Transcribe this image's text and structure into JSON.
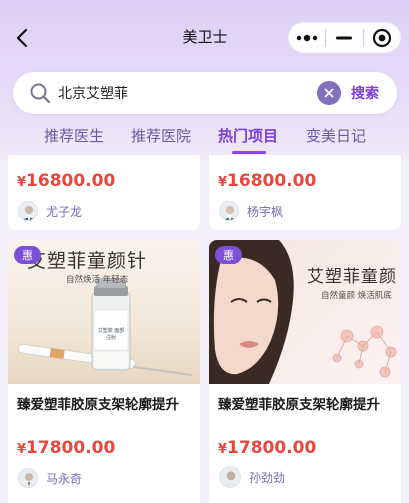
{
  "nav": {
    "title": "美卫士",
    "back_icon": "chevron-left-icon",
    "more_icon": "more-dots-icon",
    "minimize_icon": "minimize-icon",
    "close_icon": "target-close-icon"
  },
  "search": {
    "value": "北京艾塑菲",
    "placeholder": "",
    "search_label": "搜索",
    "clear_icon": "clear-icon"
  },
  "tabs": [
    {
      "label": "推荐医生",
      "active": false
    },
    {
      "label": "推荐医院",
      "active": false
    },
    {
      "label": "热门项目",
      "active": true
    },
    {
      "label": "变美日记",
      "active": false
    }
  ],
  "products": [
    {
      "price": "16800.00",
      "doctor": "尤子龙"
    },
    {
      "price": "16800.00",
      "doctor": "杨宇枫"
    },
    {
      "badge": "惠",
      "image_title": "艾塑菲童颜针",
      "image_subtitle": "自然焕活 年轻态",
      "vial_label": "艾塑菲 面部注射",
      "title": "臻爱塑菲胶原支架轮廓提升",
      "price": "17800.00",
      "doctor": "马永奇"
    },
    {
      "badge": "惠",
      "image_title": "艾塑菲童颜",
      "image_subtitle": "自然童颜 焕活肌底",
      "title": "臻爱塑菲胶原支架轮廓提升",
      "price": "17800.00",
      "doctor": "孙劲劲"
    }
  ],
  "currency": "¥",
  "colors": {
    "accent": "#7a3fd6",
    "price": "#e8473d",
    "doctor_name": "#7b69b3"
  }
}
